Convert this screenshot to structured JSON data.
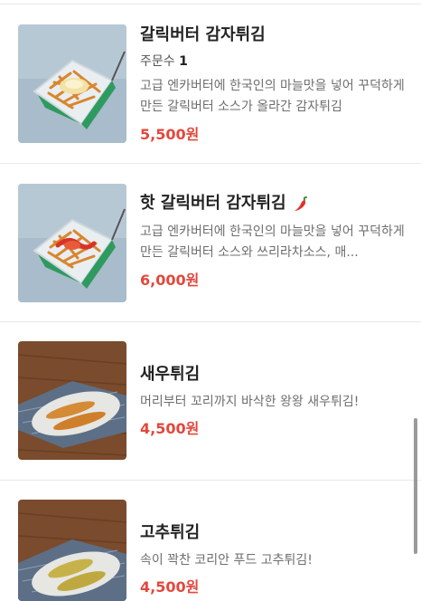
{
  "menu": {
    "items": [
      {
        "name": "갈릭버터 감자튀김",
        "orders_label": "주문수",
        "orders_count": "1",
        "description": "고급 엔카버터에 한국인의 마늘맛을 넣어 꾸덕하게 만든 갈릭버터 소스가 올라간 감자튀김",
        "price": "5,500원",
        "image_icon": "garlic-butter-fries-photo"
      },
      {
        "name": "핫 갈릭버터 감자튀김",
        "badge_icon": "chili-pepper-icon",
        "description": "고급 엔카버터에 한국인의 마늘맛을 넣어 꾸덕하게 만든 갈릭버터 소스와 쓰리라차소스, 매...",
        "price": "6,000원",
        "image_icon": "hot-garlic-butter-fries-photo"
      },
      {
        "name": "새우튀김",
        "description": "머리부터 꼬리까지 바삭한 왕왕 새우튀김!",
        "price": "4,500원",
        "image_icon": "fried-shrimp-photo"
      },
      {
        "name": "고추튀김",
        "description": "속이 꽉찬 코리안 푸드 고추튀김!",
        "price": "4,500원",
        "image_icon": "fried-pepper-photo"
      }
    ]
  },
  "colors": {
    "price": "#e2483d",
    "divider": "#e9e9e9",
    "description": "#6e6e6e"
  }
}
